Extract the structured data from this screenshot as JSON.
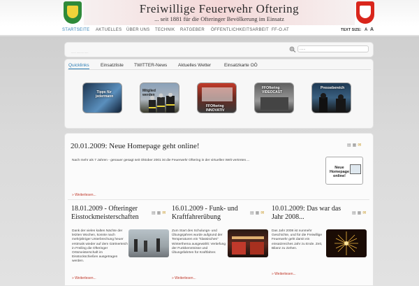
{
  "header": {
    "title": "Freiwillige Feuerwehr Oftering",
    "subtitle": "... seit 1881 für die Ofteringer Bevölkerung im Einsatz"
  },
  "nav": {
    "items": [
      "STARTSEITE",
      "AKTUELLES",
      "ÜBER UNS",
      "TECHNIK",
      "RATGEBER",
      "ÖFFENTLICHKEITSARBEIT",
      "FF-O.AT"
    ],
    "active": "STARTSEITE",
    "textsize_label": "TEXT SIZE:",
    "textsize_small": "A",
    "textsize_large": "A"
  },
  "search": {
    "breadcrumb": "...... ......... .....",
    "placeholder": "......"
  },
  "tabs": {
    "items": [
      "Quicklinks",
      "Einsatzliste",
      "TWITTER-News",
      "Aktuelles Wetter",
      "Einsatzkarte OÖ"
    ],
    "active": "Quicklinks"
  },
  "quicklinks": [
    {
      "label": "Tipps für jedermann"
    },
    {
      "label": "Mitglied werden"
    },
    {
      "label": "FFOftering INNOVATIV"
    },
    {
      "label": "FFOftering VIDEOCAST"
    },
    {
      "label": "Pressebereich"
    }
  ],
  "posts": {
    "featured": {
      "title": "20.01.2009: Neue Homepage geht online!",
      "text": "Nach mehr als 7 Jahren - genauer gesagt seit Oktober 2001 ist die Feuerwehr Oftering in der virtuellen Welt vertreten....",
      "badge": "Neue Homepage online!",
      "read_more": "» Weiterlesen..."
    },
    "columns": [
      {
        "title": "18.01.2009 - Ofteringer Eisstockmeisterschaften",
        "text": "Dank der vielen kalten Nächte der letzten Wochen, konnte nach mehrjähriger Unterbrechung heuer erstmals wieder auf dem Gärtnerteich in Freiling die Ofteringer Ortsmeisterschaft im Eisstockschießen ausgetragen werden.",
        "read_more": "» Weiterlesen..."
      },
      {
        "title": "16.01.2009 - Funk- und Kraftfahrerübung",
        "text": "Zum Start des Schulungs- und Übungsjahres wurde aufgrund der Temperaturen ein \"klassisches\" Winterthema ausgewählt: Vertiefung der Funkkenntnisse und Übungsfahrten für Kraftfahrer.",
        "read_more": "» Weiterlesen..."
      },
      {
        "title": "10.01.2009: Das war das Jahr 2008...",
        "text": "Das Jahr 2008 ist nunmehr Geschichte, und für die Freiwillige Feuerwehr geht damit ein einsatzreiches Jahr zu Ende. Zeit, Bilanz zu ziehen.",
        "read_more": "» Weiterlesen..."
      }
    ]
  },
  "icons": [
    "print-icon",
    "pdf-icon",
    "email-icon",
    "search-icon"
  ],
  "colors": {
    "accent": "#2f7fb5",
    "read_more": "#c0392b",
    "crest_left": "#2f8a3a",
    "crest_right": "#d9261c"
  }
}
